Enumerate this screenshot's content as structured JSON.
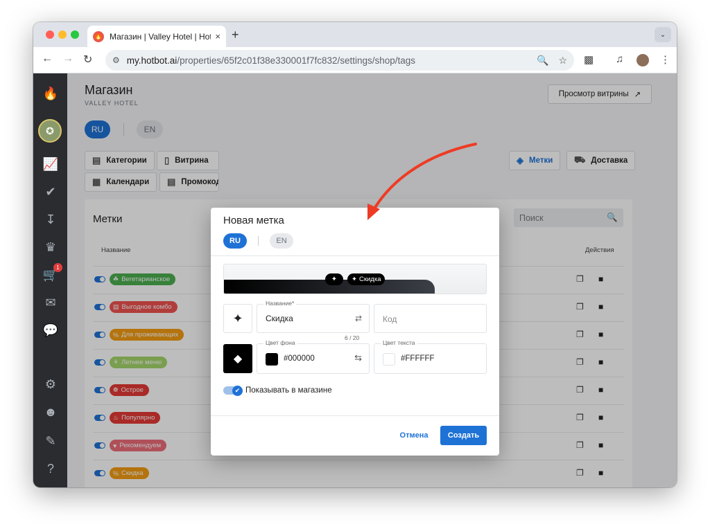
{
  "browser": {
    "tab_title": "Магазин | Valley Hotel | Hotbot",
    "tab_close": "×",
    "new_tab": "+",
    "url_host": "my.hotbot.ai",
    "url_path": "/properties/65f2c01f38e330001f7fc832/settings/shop/tags"
  },
  "page": {
    "title": "Магазин",
    "subtitle": "VALLEY HOTEL",
    "preview_button": "Просмотр витрины",
    "lang_ru": "RU",
    "lang_en": "EN"
  },
  "tabs": [
    {
      "label": "Категории",
      "icon": "category-icon"
    },
    {
      "label": "Витрина",
      "icon": "showcase-icon"
    },
    {
      "label": "Метки",
      "icon": "tag-icon"
    },
    {
      "label": "Доставка",
      "icon": "truck-icon"
    },
    {
      "label": "Календари",
      "icon": "calendar-icon"
    },
    {
      "label": "Промокоды",
      "icon": "promo-icon"
    }
  ],
  "tags_card": {
    "title": "Метки",
    "search_placeholder": "Поиск",
    "col_name": "Название",
    "col_actions": "Действия",
    "rows": [
      {
        "label": "Вегетарианское",
        "color": "#4caf50",
        "icon": "leaf-icon"
      },
      {
        "label": "Выгодное комбо",
        "color": "#ef5350",
        "icon": "combo-icon"
      },
      {
        "label": "Для проживающих",
        "color": "#f39c12",
        "icon": "percent-icon"
      },
      {
        "label": "Летнее меню",
        "color": "#a5d66b",
        "icon": "sprout-icon"
      },
      {
        "label": "Острое",
        "color": "#e53935",
        "icon": "pepper-icon"
      },
      {
        "label": "Популярно",
        "color": "#e53935",
        "icon": "fire-icon"
      },
      {
        "label": "Рекомендуем",
        "color": "#ec6d78",
        "icon": "heart-icon"
      },
      {
        "label": "Скидка",
        "color": "#f39c12",
        "icon": "percent-icon"
      }
    ]
  },
  "modal": {
    "title": "Новая метка",
    "lang_ru": "RU",
    "lang_en": "EN",
    "preview_tag": "Скидка",
    "name_label": "Название*",
    "name_value": "Скидка",
    "name_counter": "6 / 20",
    "code_placeholder": "Код",
    "bg_label": "Цвет фона",
    "bg_value": "#000000",
    "text_color_label": "Цвет текста",
    "text_color_value": "#FFFFFF",
    "show_in_shop": "Показывать в магазине",
    "cancel": "Отмена",
    "create": "Создать"
  },
  "sidebar": {
    "cart_badge": "1"
  },
  "colors": {
    "accent": "#1e72d6",
    "sidebar_bg": "#2a2c30",
    "annotation_arrow": "#ee3b24"
  }
}
